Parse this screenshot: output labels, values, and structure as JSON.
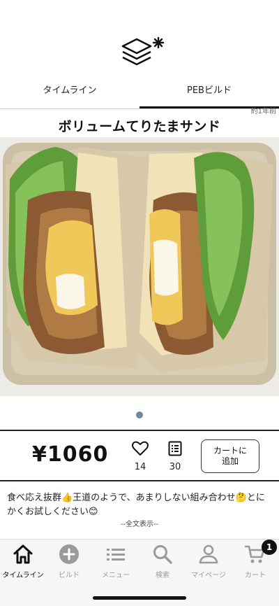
{
  "header": {
    "logo_icon": "layers-asterisk-logo"
  },
  "tabs": [
    {
      "label": "タイムライン",
      "active": false
    },
    {
      "label": "PEBビルド",
      "active": true
    }
  ],
  "post": {
    "time_ago": "約1年前",
    "title": "ボリュームてりたまサンド",
    "image_description_icon": "sandwich-photo",
    "carousel": {
      "current": 1,
      "total": 1
    },
    "price": "¥1060",
    "likes": "14",
    "comments": "30",
    "cart_button_label": "カートに\n追加",
    "description": "食べ応え抜群👍王道のようで、あまりしない組み合わせ🤔とにかくお試しください😊",
    "read_more": "--全文表示--"
  },
  "bottom_nav": {
    "items": [
      {
        "label": "タイムライン",
        "icon": "home-icon",
        "active": true
      },
      {
        "label": "ビルド",
        "icon": "plus-circle-icon",
        "active": false
      },
      {
        "label": "メニュー",
        "icon": "menu-list-icon",
        "active": false
      },
      {
        "label": "検索",
        "icon": "search-icon",
        "active": false
      },
      {
        "label": "マイページ",
        "icon": "user-icon",
        "active": false
      },
      {
        "label": "カート",
        "icon": "cart-icon",
        "active": false,
        "badge": "1"
      }
    ]
  },
  "colors": {
    "dot_active": "#6f8aa0",
    "nav_inactive": "#9a9a9a",
    "nav_active": "#111111"
  }
}
